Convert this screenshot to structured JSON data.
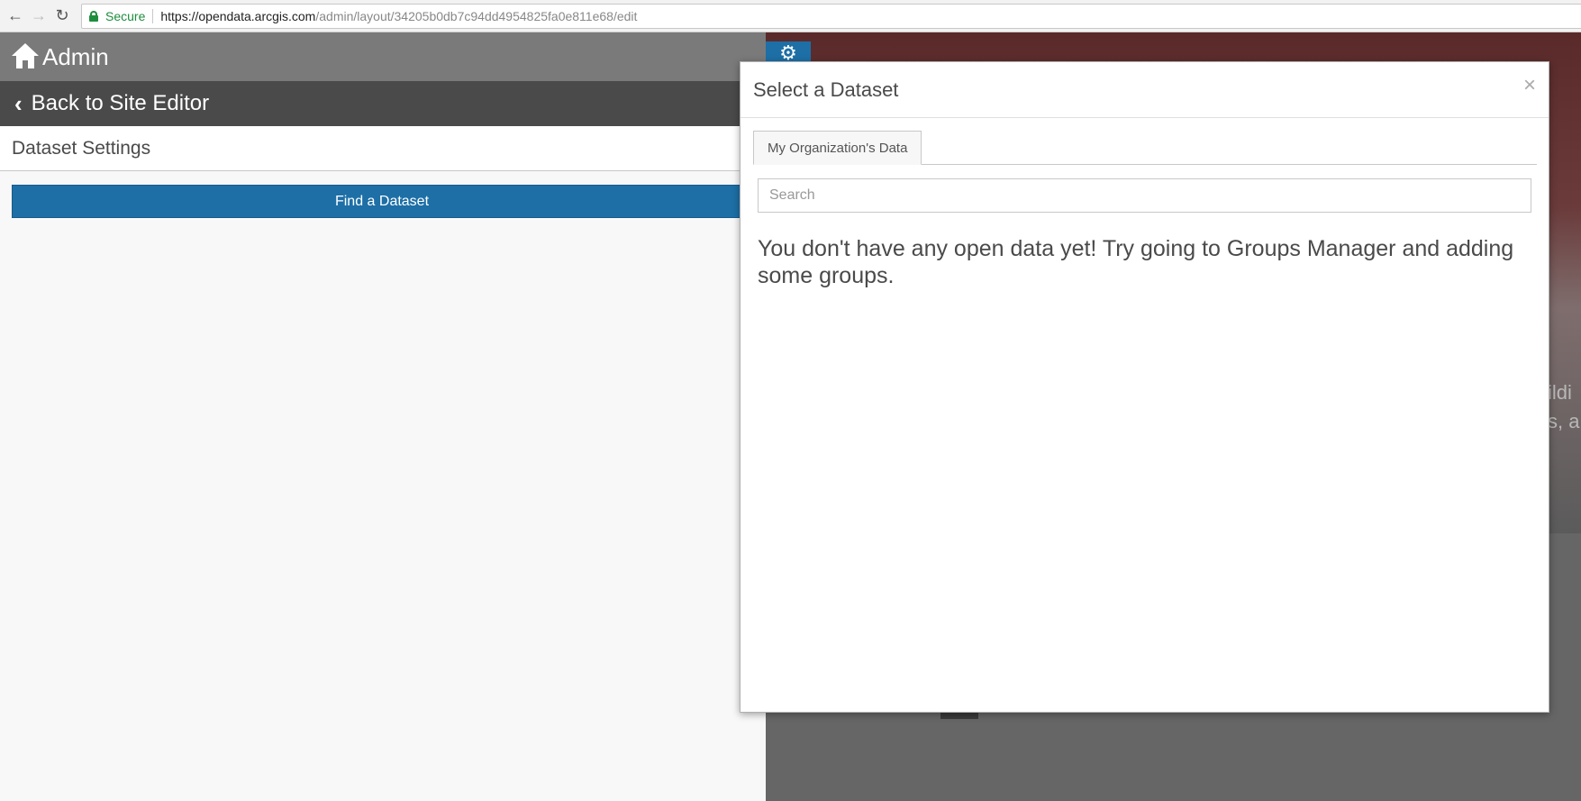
{
  "browser": {
    "secure_label": "Secure",
    "url_host": "https://opendata.arcgis.com",
    "url_path": "/admin/layout/34205b0db7c94dd4954825fa0e811e68/edit"
  },
  "sidebar": {
    "admin_title": "Admin",
    "back_label": "Back to Site Editor",
    "settings_heading": "Dataset Settings",
    "find_dataset_label": "Find a Dataset"
  },
  "background": {
    "fragment_1": "ildi",
    "fragment_2": "s, a"
  },
  "modal": {
    "title": "Select a Dataset",
    "close_glyph": "×",
    "tabs": [
      {
        "label": "My Organization's Data",
        "active": true
      }
    ],
    "search": {
      "placeholder": "Search",
      "value": ""
    },
    "empty_message": "You don't have any open data yet! Try going to Groups Manager and adding some groups."
  },
  "colors": {
    "primary_button": "#1d6fa6",
    "admin_header": "#7a7a7a",
    "back_bar": "#4a4a4a",
    "secure_green": "#1e8e3e"
  },
  "icons": [
    "back-arrow-icon",
    "forward-arrow-icon",
    "reload-icon",
    "lock-icon",
    "home-icon",
    "chevron-left-icon",
    "gear-icon",
    "close-icon"
  ]
}
